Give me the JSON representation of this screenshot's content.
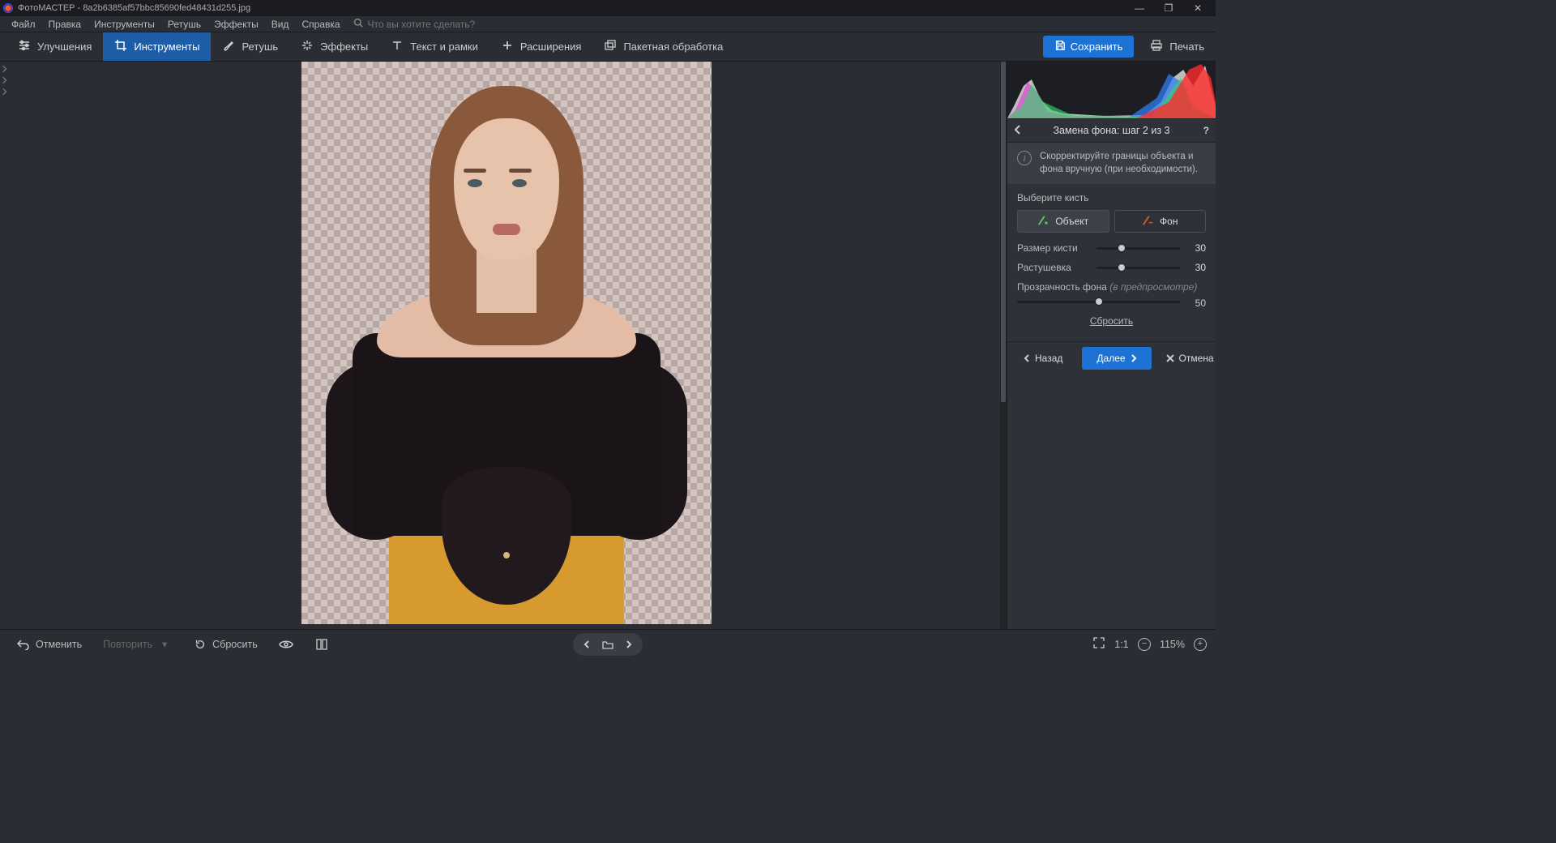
{
  "app": {
    "name": "ФотоМАСТЕР",
    "filename": "8a2b6385af57bbc85690fed48431d255.jpg"
  },
  "menubar": {
    "items": [
      "Файл",
      "Правка",
      "Инструменты",
      "Ретушь",
      "Эффекты",
      "Вид",
      "Справка"
    ],
    "search_placeholder": "Что вы хотите сделать?"
  },
  "tooltabs": {
    "items": [
      {
        "label": "Улучшения",
        "icon": "sliders-icon"
      },
      {
        "label": "Инструменты",
        "icon": "crop-icon",
        "active": true
      },
      {
        "label": "Ретушь",
        "icon": "brush-icon"
      },
      {
        "label": "Эффекты",
        "icon": "sparkle-icon"
      },
      {
        "label": "Текст и рамки",
        "icon": "text-icon"
      },
      {
        "label": "Расширения",
        "icon": "plus-icon"
      },
      {
        "label": "Пакетная обработка",
        "icon": "batch-icon"
      }
    ],
    "save": "Сохранить",
    "print": "Печать"
  },
  "panel": {
    "title": "Замена фона: шаг 2 из 3",
    "info": "Скорректируйте границы объекта и фона вручную (при необходимости).",
    "choose_brush": "Выберите кисть",
    "brush_object": "Объект",
    "brush_background": "Фон",
    "sliders": {
      "size_label": "Размер кисти",
      "size_value": 30,
      "feather_label": "Растушевка",
      "feather_value": 30,
      "opacity_label": "Прозрачность фона",
      "opacity_note": "(в предпросмотре)",
      "opacity_value": 50
    },
    "reset": "Сбросить",
    "nav": {
      "back": "Назад",
      "next": "Далее",
      "cancel": "Отмена"
    }
  },
  "bottombar": {
    "undo": "Отменить",
    "redo": "Повторить",
    "reset": "Сбросить",
    "zoom": {
      "ratio": "1:1",
      "percent": "115%"
    }
  }
}
